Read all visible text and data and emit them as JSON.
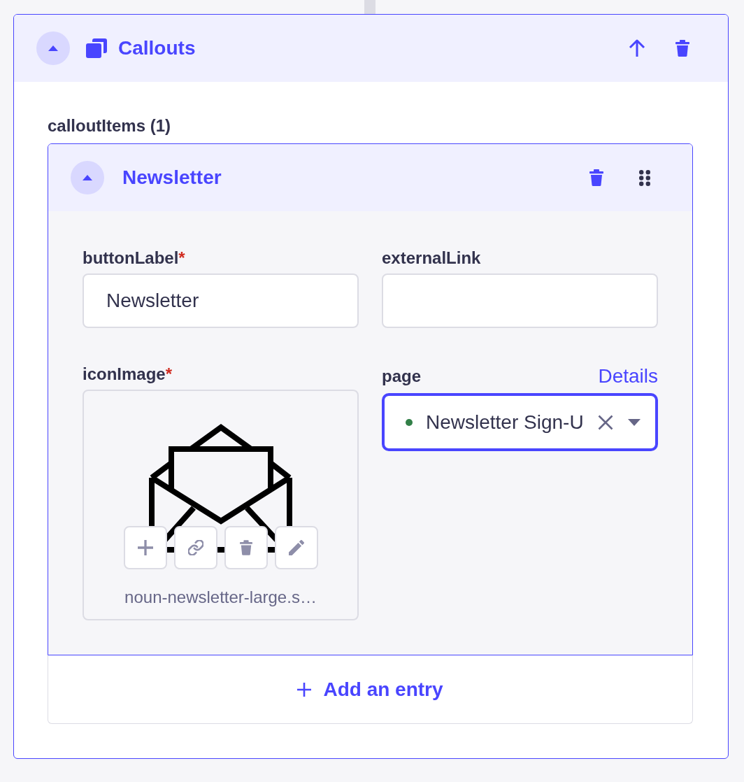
{
  "component": {
    "title": "Callouts",
    "expanded": true
  },
  "repeatable": {
    "label": "calloutItems (1)",
    "entries": [
      {
        "title": "Newsletter",
        "expanded": true,
        "fields": [
          {
            "kind": "text",
            "label": "buttonLabel",
            "required_mark": "*",
            "value": "Newsletter",
            "focused": false
          },
          {
            "kind": "text",
            "label": "externalLink",
            "focused": false
          },
          {
            "kind": "media",
            "label": "iconImage",
            "required_mark": "*",
            "filename": "noun-newsletter-large.s…",
            "focused": false
          },
          {
            "kind": "relation",
            "label": "page",
            "link": "Details",
            "value": "Newsletter Sign-U",
            "published": true,
            "focused": true
          }
        ]
      }
    ],
    "add_label": "Add an entry"
  }
}
